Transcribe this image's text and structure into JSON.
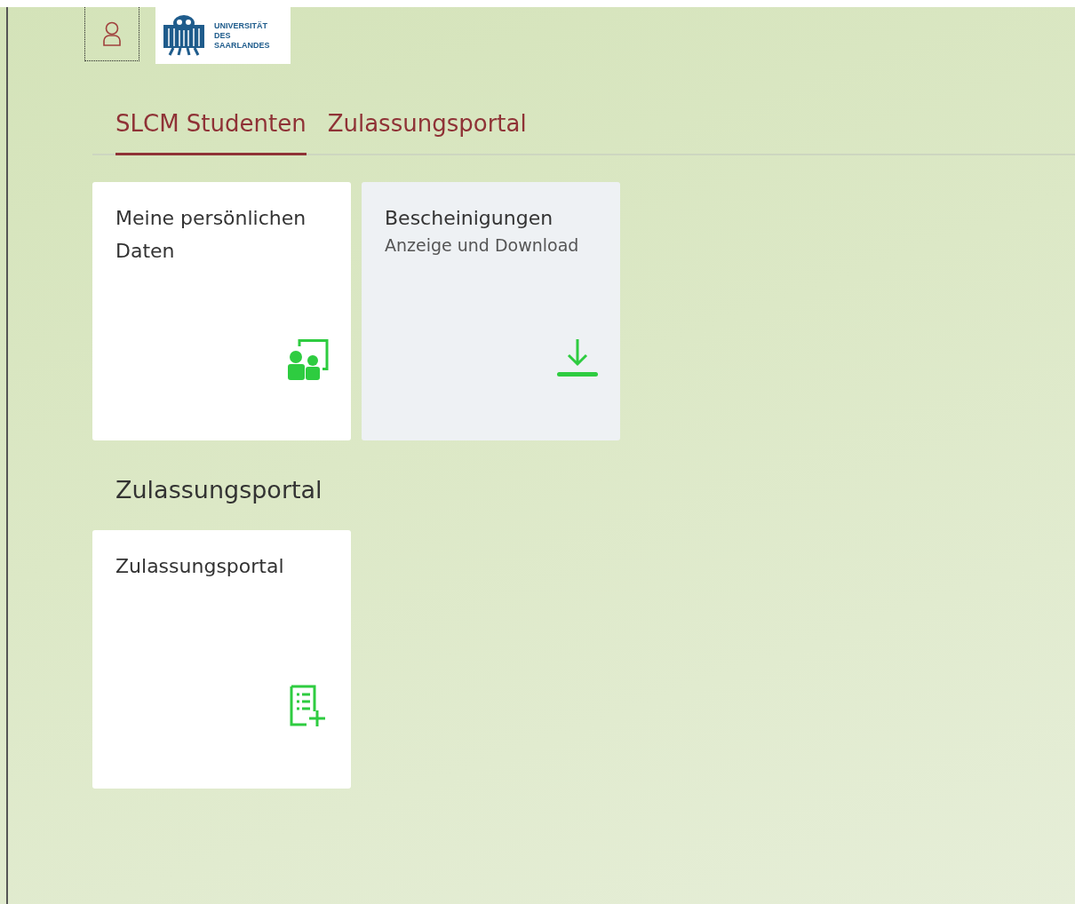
{
  "header": {
    "logo": {
      "lines": [
        "UNIVERSITÄT",
        "DES",
        "SAARLANDES"
      ]
    }
  },
  "tabs": [
    {
      "label": "SLCM Studenten",
      "selected": true
    },
    {
      "label": "Zulassungsportal",
      "selected": false
    }
  ],
  "sections": [
    {
      "tiles": [
        {
          "title": "Meine persönlichen Daten",
          "kind": "people",
          "hovered": false
        },
        {
          "title": "Bescheinigungen",
          "subtitle": "Anzeige und Download",
          "kind": "download",
          "hovered": true
        }
      ]
    },
    {
      "heading": "Zulassungsportal",
      "tiles": [
        {
          "title": "Zulassungsportal",
          "kind": "form-add",
          "hovered": false
        }
      ]
    }
  ]
}
